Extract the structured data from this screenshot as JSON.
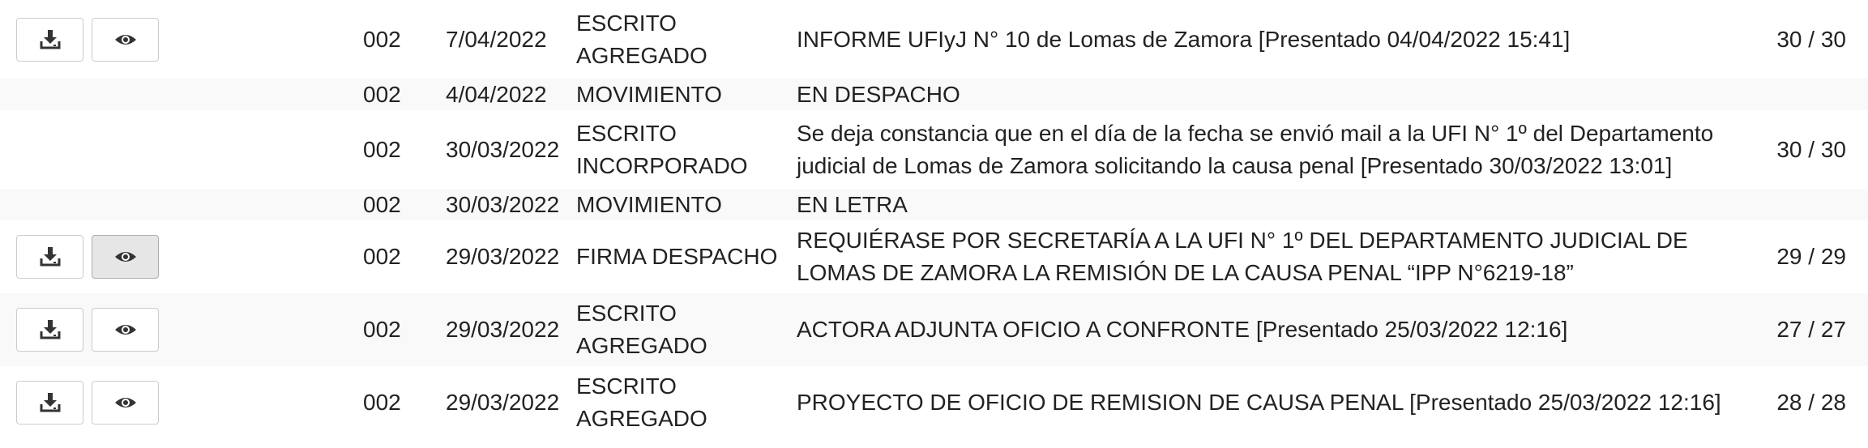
{
  "rows": [
    {
      "has_buttons": true,
      "eye_active": false,
      "num": "002",
      "date": "7/04/2022",
      "type": "ESCRITO\nAGREGADO",
      "desc": "INFORME UFIyJ N° 10 de Lomas de Zamora [Presentado 04/04/2022 15:41]",
      "pages": "30 / 30"
    },
    {
      "has_buttons": false,
      "num": "002",
      "date": "4/04/2022",
      "type": "MOVIMIENTO",
      "desc": "EN DESPACHO",
      "pages": ""
    },
    {
      "has_buttons": false,
      "num": "002",
      "date": "30/03/2022",
      "type": "ESCRITO\nINCORPORADO",
      "desc": "Se deja constancia que en el día de la fecha se envió mail a la UFI N° 1º del Departamento judicial de Lomas de Zamora solicitando la causa penal [Presentado 30/03/2022 13:01]",
      "pages": "30 / 30"
    },
    {
      "has_buttons": false,
      "num": "002",
      "date": "30/03/2022",
      "type": "MOVIMIENTO",
      "desc": "EN LETRA",
      "pages": ""
    },
    {
      "has_buttons": true,
      "eye_active": true,
      "num": "002",
      "date": "29/03/2022",
      "type": "FIRMA DESPACHO",
      "desc": "REQUIÉRASE POR SECRETARÍA A LA UFI N° 1º DEL DEPARTAMENTO JUDICIAL DE LOMAS DE ZAMORA LA REMISIÓN DE LA CAUSA PENAL “IPP N°6219-18”",
      "pages": "29 / 29"
    },
    {
      "has_buttons": true,
      "eye_active": false,
      "num": "002",
      "date": "29/03/2022",
      "type": "ESCRITO\nAGREGADO",
      "desc": "ACTORA ADJUNTA OFICIO A CONFRONTE [Presentado 25/03/2022 12:16]",
      "pages": "27 / 27"
    },
    {
      "has_buttons": true,
      "eye_active": false,
      "num": "002",
      "date": "29/03/2022",
      "type": "ESCRITO\nAGREGADO",
      "desc": "PROYECTO DE OFICIO DE REMISION DE CAUSA PENAL [Presentado 25/03/2022 12:16]",
      "pages": "28 / 28"
    }
  ],
  "icons": {
    "download": "download-icon",
    "view": "eye-icon"
  },
  "colors": {
    "row_stripe": "#f9f9f9",
    "button_border": "#cccccc",
    "button_active_bg": "#e6e6e6",
    "text": "#222222"
  }
}
